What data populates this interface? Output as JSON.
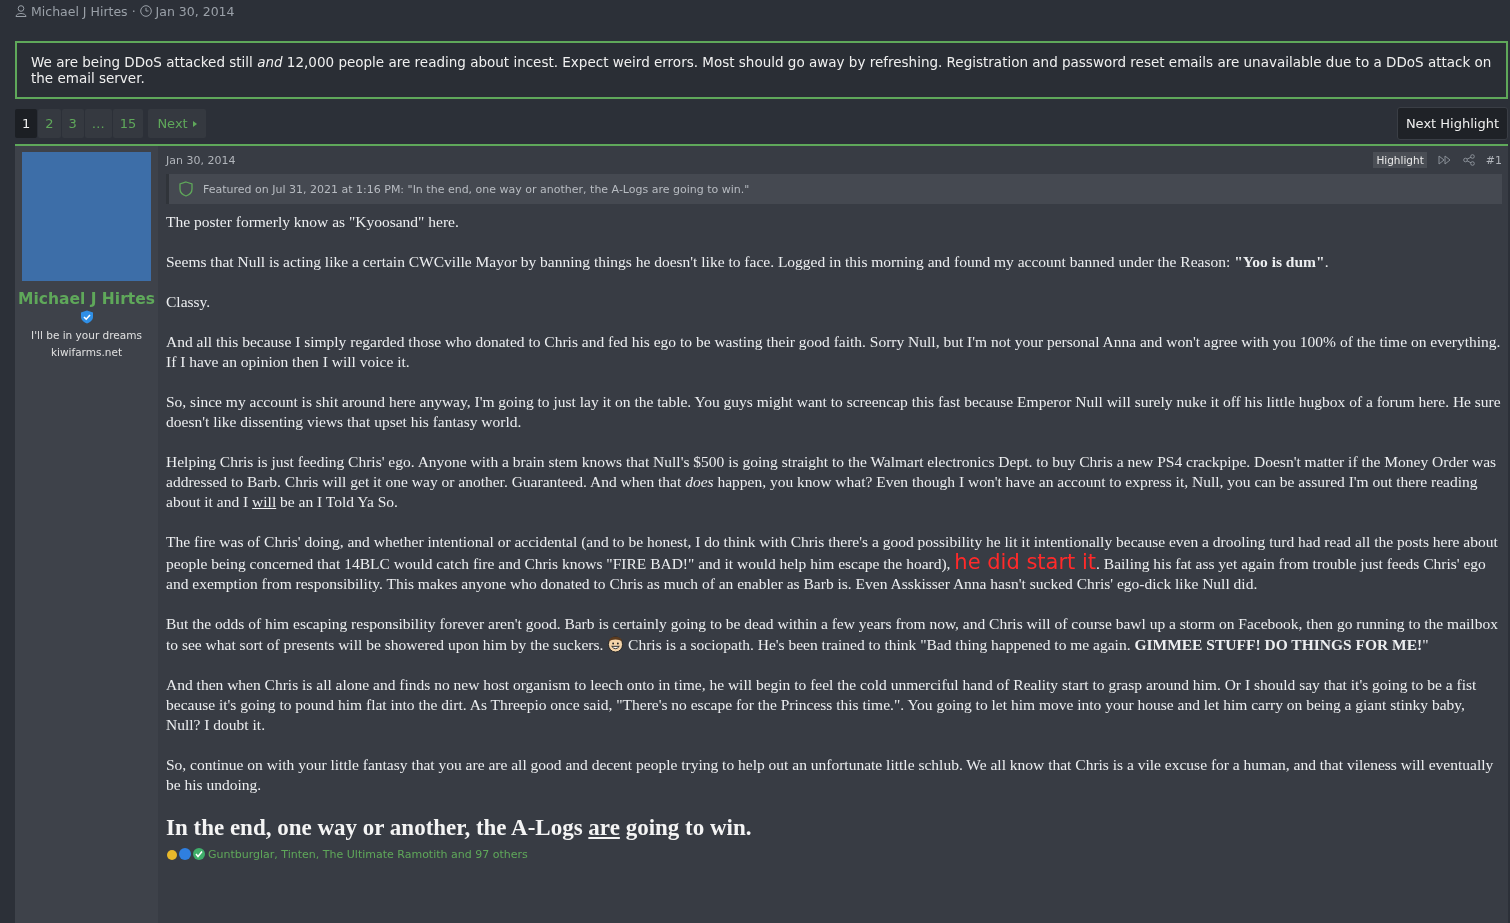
{
  "byline": {
    "author": "Michael J Hirtes",
    "separator": "·",
    "date": "Jan 30, 2014"
  },
  "notice": "We are being DDoS attacked still *and* 12,000 people are reading about incest. Expect weird errors. Most should go away by refreshing. Registration and password reset emails are unavailable due to a DDoS attack on the email server.",
  "pagination": {
    "pages": [
      {
        "label": "1",
        "selected": true
      },
      {
        "label": "2",
        "selected": false
      },
      {
        "label": "3",
        "selected": false
      },
      {
        "label": "…",
        "selected": false
      },
      {
        "label": "15",
        "selected": false
      }
    ],
    "next": "Next"
  },
  "next_highlight": "Next Highlight",
  "post": {
    "username": "Michael J Hirtes",
    "user_title": "I'll be in your dreams",
    "user_site": "kiwifarms.net",
    "date": "Jan 30, 2014",
    "highlight_label": "Highlight",
    "post_number": "#1",
    "featured": "Featured on Jul 31, 2021 at 1:16 PM: \"In the end, one way or another, the A-Logs are going to win.\"",
    "paragraphs": [
      [
        {
          "kind": "text",
          "text": "The poster formerly know as \"Kyoosand\" here."
        }
      ],
      [
        {
          "kind": "text",
          "text": "Seems that Null is acting like a certain CWCville Mayor by banning things he doesn't like to face. Logged in this morning and found my account banned under the Reason: "
        },
        {
          "kind": "bold",
          "text": "\"Yoo is dum\""
        },
        {
          "kind": "text",
          "text": "."
        }
      ],
      [
        {
          "kind": "text",
          "text": "Classy."
        }
      ],
      [
        {
          "kind": "text",
          "text": "And all this because I simply regarded those who donated to Chris and fed his ego to be wasting their good faith. Sorry Null, but I'm not your personal Anna and won't agree with you 100% of the time on everything. If I have an opinion then I will voice it."
        }
      ],
      [
        {
          "kind": "text",
          "text": "So, since my account is shit around here anyway, I'm going to just lay it on the table. You guys might want to screencap this fast because Emperor Null will surely nuke it off his little hugbox of a forum here. He sure doesn't like dissenting views that upset his fantasy world."
        }
      ],
      [
        {
          "kind": "text",
          "text": "Helping Chris is just feeding Chris' ego. Anyone with a brain stem knows that Null's $500 is going straight to the Walmart electronics Dept. to buy Chris a new PS4 crackpipe. Doesn't matter if the Money Order was addressed to Barb. Chris will get it one way or another. Guaranteed. And when that "
        },
        {
          "kind": "italic",
          "text": "does"
        },
        {
          "kind": "text",
          "text": " happen, you know what? Even though I won't have an account to express it, Null, you can be assured I'm out there reading about it and I "
        },
        {
          "kind": "underline",
          "text": "will"
        },
        {
          "kind": "text",
          "text": " be an I Told Ya So."
        }
      ],
      [
        {
          "kind": "text",
          "text": "The fire was of Chris' doing, and whether intentional or accidental (and to be honest, I do think with Chris there's a good possibility he lit it intentionally because even a drooling turd had read all the posts here about people being concerned that 14BLC would catch fire and Chris knows \"FIRE BAD!\" and it would help him escape the hoard), "
        },
        {
          "kind": "emphasis",
          "text": "he did start it"
        },
        {
          "kind": "text",
          "text": ". Bailing his fat ass yet again from trouble just feeds Chris' ego and exemption from responsibility. This makes anyone who donated to Chris as much of an enabler as Barb is. Even Asskisser Anna hasn't sucked Chris' ego-dick like Null did."
        }
      ],
      [
        {
          "kind": "text",
          "text": "But the odds of him escaping responsibility forever aren't good. Barb is certainly going to be dead within a few years from now, and Chris will of course bawl up a storm on Facebook, then go running to the mailbox to see what sort of presents will be showered upon him by the suckers. "
        },
        {
          "kind": "smiley"
        },
        {
          "kind": "text",
          "text": " Chris is a sociopath. He's been trained to think \"Bad thing happened to me again. "
        },
        {
          "kind": "bold",
          "text": "GIMMEE STUFF! DO THINGS FOR ME!"
        },
        {
          "kind": "text",
          "text": "\""
        }
      ],
      [
        {
          "kind": "text",
          "text": "And then when Chris is all alone and finds no new host organism to leech onto in time, he will begin to feel the cold unmerciful hand of Reality start to grasp around him. Or I should say that it's going to be a fist because it's going to pound him flat into the dirt. As Threepio once said, \"There's no escape for the Princess this time.\". You going to let him move into your house and let him carry on being a giant stinky baby, Null? I doubt it."
        }
      ],
      [
        {
          "kind": "text",
          "text": "So, continue on with your little fantasy that you are are all good and decent people trying to help out an unfortunate little schlub. We all know that Chris is a vile excuse for a human, and that vileness will eventually be his undoing."
        }
      ]
    ],
    "closing": [
      {
        "kind": "text",
        "text": "In the end, one way or another, the A-Logs "
      },
      {
        "kind": "underline",
        "text": "are"
      },
      {
        "kind": "text",
        "text": " going to win."
      }
    ],
    "reactions": "Guntburglar, Tinten, The Ultimate Ramotith and 97 others"
  }
}
